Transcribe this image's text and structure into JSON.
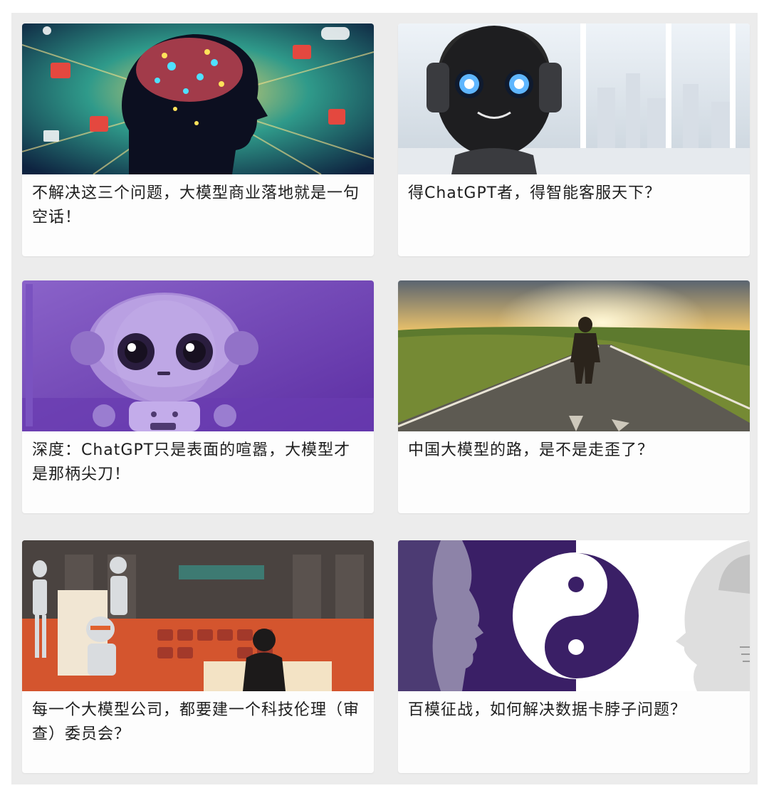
{
  "articles": [
    {
      "title": "不解决这三个问题，大模型商业落地就是一句空话！",
      "image": "ai-brain-head-illustration"
    },
    {
      "title": "得ChatGPT者，得智能客服天下？",
      "image": "robot-with-headphones-office"
    },
    {
      "title": "深度：ChatGPT只是表面的喧嚣，大模型才是那柄尖刀！",
      "image": "purple-cartoon-robot"
    },
    {
      "title": "中国大模型的路，是不是走歪了？",
      "image": "man-walking-on-road-sunset"
    },
    {
      "title": "每一个大模型公司，都要建一个科技伦理（审查）委员会？",
      "image": "robots-in-courtroom-illustration"
    },
    {
      "title": "百模征战，如何解决数据卡脖子问题？",
      "image": "human-robot-yin-yang"
    }
  ],
  "colors": {
    "background": "#ececec",
    "card": "#fdfdfd",
    "text": "#1e1e1e"
  }
}
